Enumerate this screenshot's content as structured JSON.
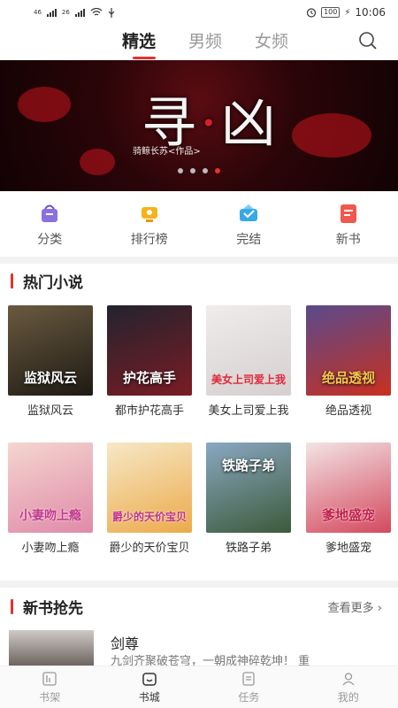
{
  "status_bar": {
    "signal1": "46",
    "signal2": "26",
    "battery": "100",
    "time": "10:06"
  },
  "top_tabs": [
    "精选",
    "男频",
    "女频"
  ],
  "banner": {
    "title_a": "寻",
    "title_b": "凶",
    "author": "骑鲸长苏<作品>"
  },
  "quick_nav": [
    "分类",
    "排行榜",
    "完结",
    "新书"
  ],
  "hot": {
    "title": "热门小说",
    "books": [
      {
        "name": "监狱风云",
        "cover_text": "监狱风云",
        "colors": [
          "#6a5a40",
          "#1e1a14"
        ]
      },
      {
        "name": "都市护花高手",
        "cover_text": "护花高手",
        "colors": [
          "#23232e",
          "#7a1c24"
        ]
      },
      {
        "name": "美女上司爱上我",
        "cover_text": "美女上司爱上我",
        "colors": [
          "#f0ecec",
          "#d5cfcf"
        ]
      },
      {
        "name": "绝品透视",
        "cover_text": "绝品透视",
        "colors": [
          "#5a4a8c",
          "#c83020"
        ]
      },
      {
        "name": "小妻吻上瘾",
        "cover_text": "小妻吻上瘾",
        "colors": [
          "#f4d6cf",
          "#e08aa8"
        ]
      },
      {
        "name": "爵少的天价宝贝",
        "cover_text": "爵少的天价宝贝",
        "colors": [
          "#f6e8c6",
          "#ecaa4a"
        ]
      },
      {
        "name": "铁路子弟",
        "cover_text": "铁路子弟",
        "colors": [
          "#8aa8c2",
          "#3c5a3a"
        ]
      },
      {
        "name": "爹地盛宠",
        "cover_text": "爹地盛宠",
        "colors": [
          "#f2e4e4",
          "#d4485e"
        ]
      }
    ]
  },
  "new_books": {
    "title": "新书抢先",
    "more": "查看更多",
    "first": {
      "title": "剑尊",
      "desc": "九剑齐聚破苍穹，一朝成神碎乾坤！ 重"
    }
  },
  "bottom_nav": [
    "书架",
    "书城",
    "任务",
    "我的"
  ],
  "colors": {
    "accent": "#e2332d"
  }
}
